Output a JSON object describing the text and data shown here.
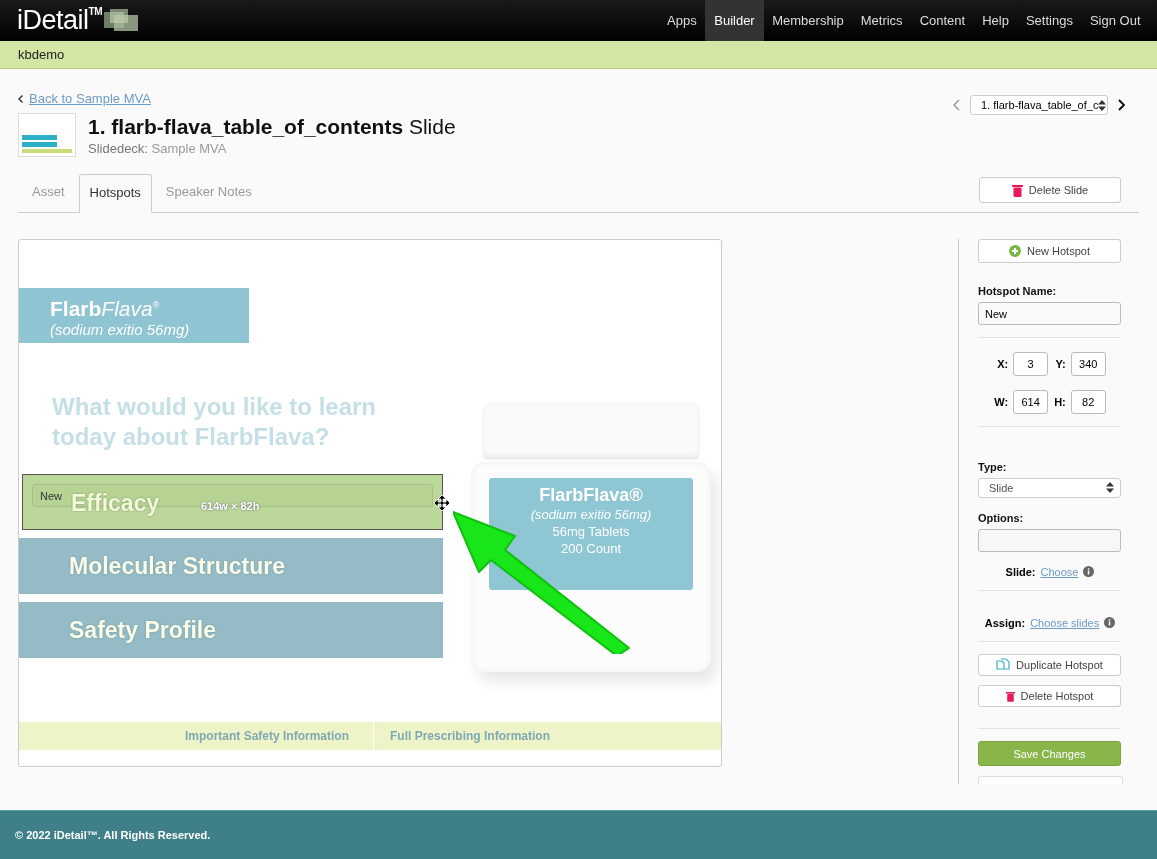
{
  "brand": {
    "name": "iDetail",
    "mark": "TM"
  },
  "nav": [
    {
      "label": "Apps",
      "selected": false
    },
    {
      "label": "Builder",
      "selected": true
    },
    {
      "label": "Membership",
      "selected": false
    },
    {
      "label": "Metrics",
      "selected": false
    },
    {
      "label": "Content",
      "selected": false
    },
    {
      "label": "Help",
      "selected": false
    },
    {
      "label": "Settings",
      "selected": false
    },
    {
      "label": "Sign Out",
      "selected": false
    }
  ],
  "account": "kbdemo",
  "back_link": "Back to Sample MVA",
  "slide_picker": {
    "value": "1. flarb-flava_table_of_c"
  },
  "title": {
    "name": "1. flarb-flava_table_of_contents",
    "suffix": "Slide",
    "deck_label": "Slidedeck:",
    "deck": "Sample MVA"
  },
  "tabs": [
    {
      "label": "Asset",
      "selected": false
    },
    {
      "label": "Hotspots",
      "selected": true
    },
    {
      "label": "Speaker Notes",
      "selected": false
    }
  ],
  "delete_slide": "Delete Slide",
  "slide": {
    "brand": "FlarbFlava",
    "brand_mark": "®",
    "dose": "(sodium exitio 56mg)",
    "question": "What would you like to learn today about FlarbFlava?",
    "menu": [
      "Efficacy",
      "Molecular Structure",
      "Safety Profile"
    ],
    "bottle_label": [
      "FlarbFlava®",
      "(sodium exitio 56mg)",
      "56mg Tablets",
      "200 Count"
    ],
    "footer_links": [
      "Important Safety Information",
      "Full Prescribing Information"
    ]
  },
  "hotspot": {
    "name": "New",
    "size": "614w × 82h"
  },
  "panel": {
    "new_button": "New Hotspot",
    "name_label": "Hotspot Name:",
    "name_value": "New",
    "coords": [
      {
        "label": "X:",
        "value": "3"
      },
      {
        "label": "Y:",
        "value": "340"
      },
      {
        "label": "W:",
        "value": "614"
      },
      {
        "label": "H:",
        "value": "82"
      }
    ],
    "type_label": "Type:",
    "type_value": "Slide",
    "options_label": "Options:",
    "slide_label": "Slide:",
    "slide_link": "Choose",
    "assign_label": "Assign:",
    "assign_link": "Choose slides",
    "duplicate": "Duplicate Hotspot",
    "delete": "Delete Hotspot",
    "save": "Save Changes"
  },
  "footer": "© 2022 iDetail™.  All Rights Reserved."
}
